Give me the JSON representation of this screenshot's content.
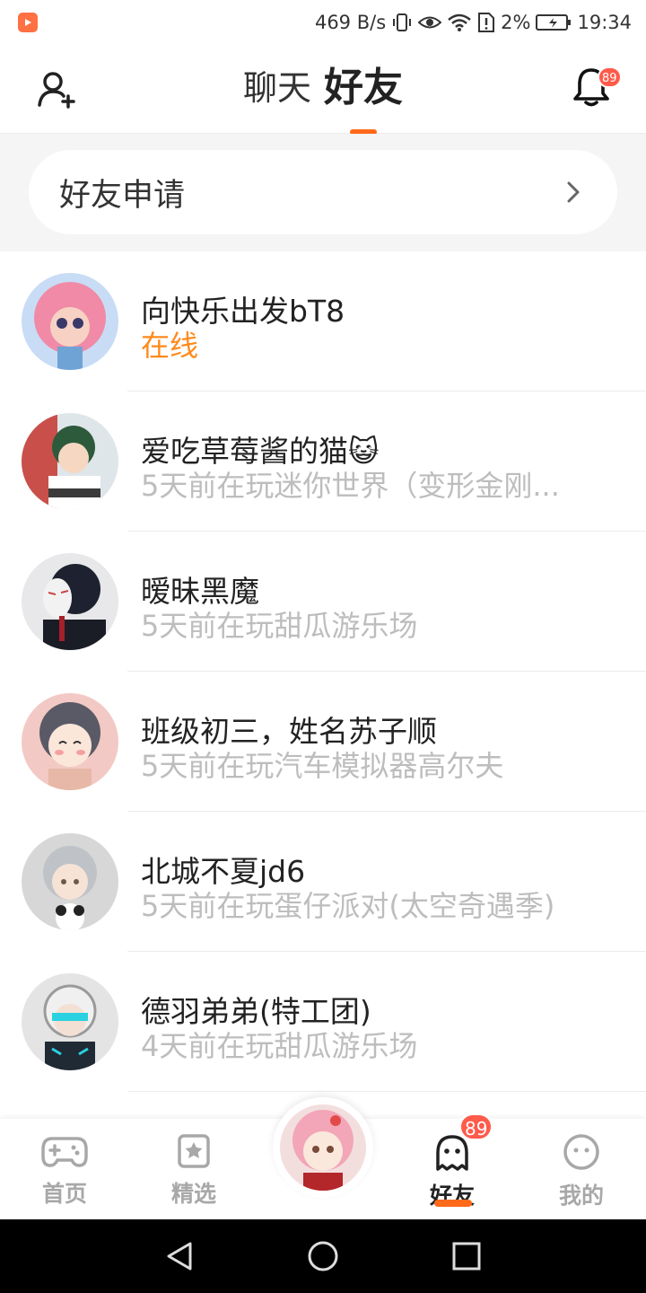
{
  "status_bar": {
    "network_speed": "469 B/s",
    "battery": "2%",
    "time": "19:34"
  },
  "header": {
    "tabs": [
      {
        "label": "聊天",
        "active": false
      },
      {
        "label": "好友",
        "active": true
      }
    ],
    "bell_badge": "89"
  },
  "friend_requests": {
    "label": "好友申请"
  },
  "friends": [
    {
      "name": "向快乐出发bT8",
      "status": "在线",
      "online": true
    },
    {
      "name": "爱吃草莓酱的猫😺",
      "status": "5天前在玩迷你世界（变形金刚...",
      "online": false
    },
    {
      "name": "暧昧黑魔",
      "status": "5天前在玩甜瓜游乐场",
      "online": false
    },
    {
      "name": "班级初三，姓名苏子顺",
      "status": "5天前在玩汽车模拟器高尔夫",
      "online": false
    },
    {
      "name": "北城不夏jd6",
      "status": "5天前在玩蛋仔派对(太空奇遇季)",
      "online": false
    },
    {
      "name": "德羽弟弟(特工团)",
      "status": "4天前在玩甜瓜游乐场",
      "online": false
    }
  ],
  "bottom_nav": {
    "home": "首页",
    "featured": "精选",
    "friends": "好友",
    "friends_badge": "89",
    "mine": "我的",
    "active": "friends"
  },
  "colors": {
    "accent": "#ff6a1a",
    "online": "#ff8a1c",
    "badge": "#ff5a4a",
    "secondary_text": "#bdbdbd"
  }
}
